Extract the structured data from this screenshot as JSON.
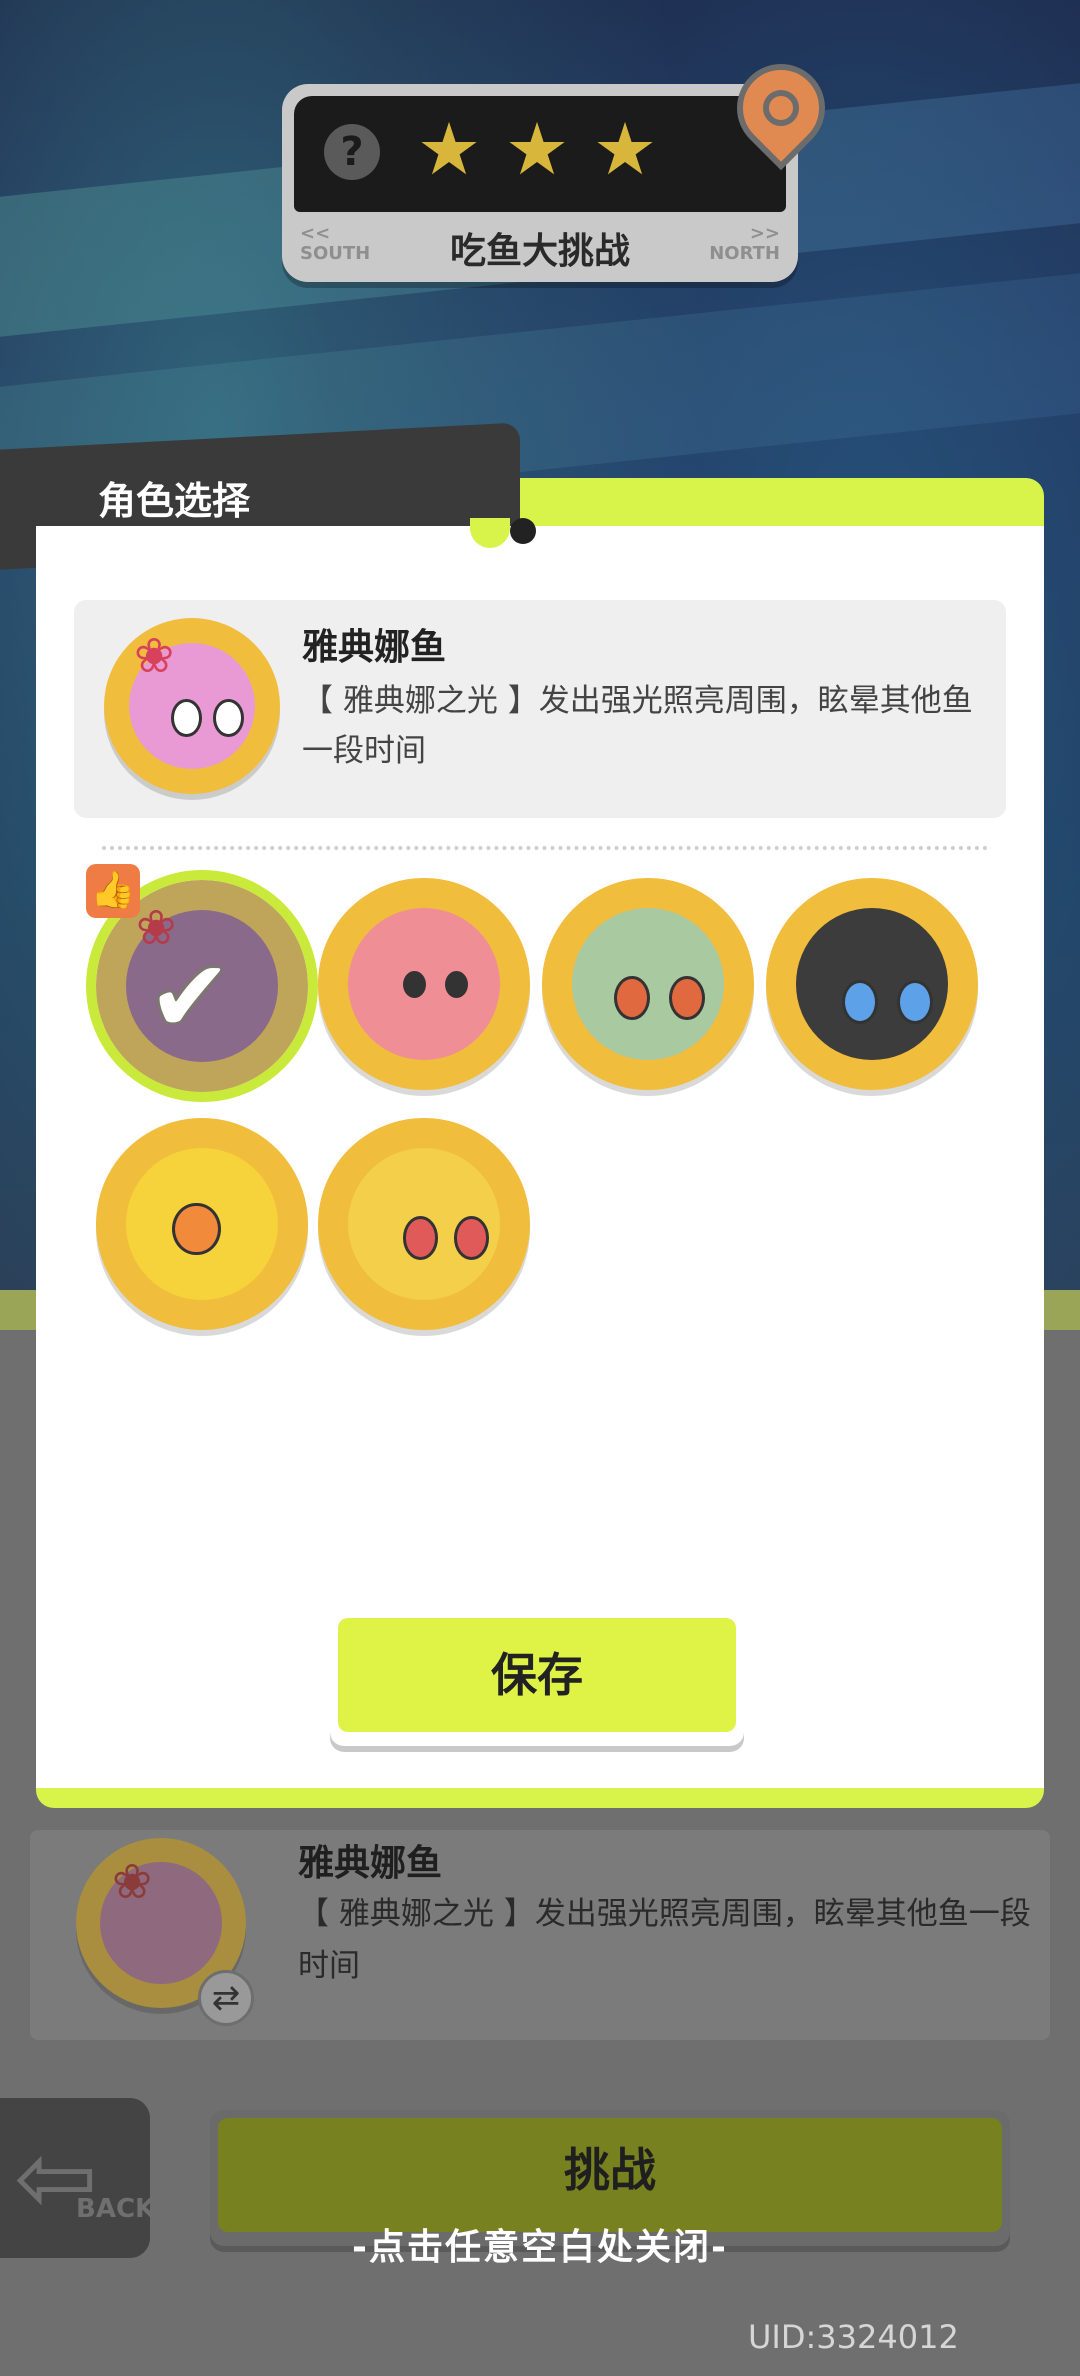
{
  "level": {
    "title": "吃鱼大挑战",
    "help_glyph": "?",
    "stars": [
      "★",
      "★",
      "★"
    ],
    "left_label": "<<\nSOUTH",
    "right_label": ">>\nNORTH"
  },
  "modal": {
    "tab_title": "角色选择",
    "selected": {
      "name": "雅典娜鱼",
      "description": "【 雅典娜之光 】发出强光照亮周围，眩晕其他鱼一段时间"
    },
    "characters": [
      {
        "name": "athena-fish",
        "selected": true,
        "recommended": true
      },
      {
        "name": "pink-fish",
        "selected": false
      },
      {
        "name": "green-fish",
        "selected": false
      },
      {
        "name": "black-fish",
        "selected": false
      },
      {
        "name": "yellow-shark-fish",
        "selected": false
      },
      {
        "name": "yellow-star-fish",
        "selected": false
      }
    ],
    "save_label": "保存"
  },
  "panel": {
    "name": "雅典娜鱼",
    "description": "【 雅典娜之光 】发出强光照亮周围，眩晕其他鱼一段时间"
  },
  "back_label": "BACK",
  "challenge_label": "挑战",
  "close_hint": "-点击任意空白处关闭-",
  "uid": "UID:3324012",
  "colors": {
    "accent_lime": "#d8f34a",
    "avatar_gold": "#f1bd3c"
  }
}
